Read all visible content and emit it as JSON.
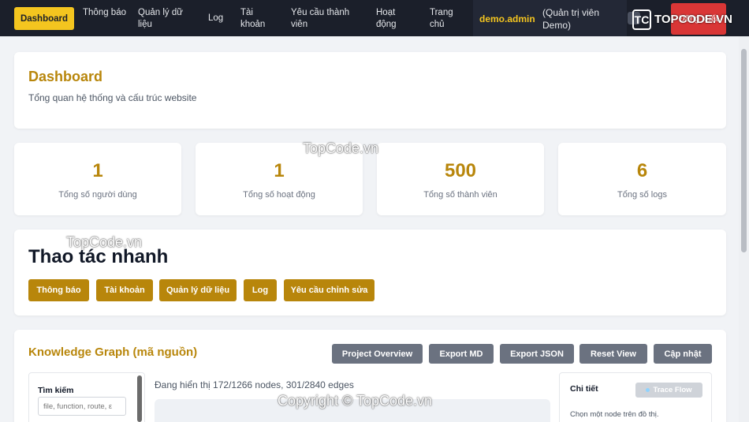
{
  "nav": {
    "items": [
      {
        "label": "Dashboard"
      },
      {
        "label": "Thông báo"
      },
      {
        "label": "Quản lý dữ liệu"
      },
      {
        "label": "Log"
      },
      {
        "label": "Tài khoản"
      },
      {
        "label": "Yêu cầu thành viên"
      },
      {
        "label": "Hoạt động"
      },
      {
        "label": "Trang chủ"
      }
    ],
    "user_name": "demo.admin",
    "user_role": "(Quản trị viên Demo)",
    "logout_label": "Đăng xuất"
  },
  "dashboard": {
    "title": "Dashboard",
    "subtitle": "Tổng quan hệ thống và cấu trúc website"
  },
  "stats": [
    {
      "value": "1",
      "label": "Tổng số người dùng"
    },
    {
      "value": "1",
      "label": "Tổng số hoạt động"
    },
    {
      "value": "500",
      "label": "Tổng số thành viên"
    },
    {
      "value": "6",
      "label": "Tổng số logs"
    }
  ],
  "quick_actions": {
    "title": "Thao tác nhanh",
    "buttons": [
      "Thông báo",
      "Tài khoản",
      "Quản lý dữ liệu",
      "Log",
      "Yêu cầu chỉnh sửa"
    ]
  },
  "knowledge_graph": {
    "title": "Knowledge Graph (mã nguồn)",
    "buttons": [
      "Project Overview",
      "Export MD",
      "Export JSON",
      "Reset View",
      "Cập nhật"
    ],
    "search_label": "Tìm kiếm",
    "search_placeholder": "file, function, route, ε",
    "status": "Đang hiển thị 172/1266 nodes, 301/2840 edges",
    "detail_title": "Chi tiết",
    "trace_label": "Trace Flow",
    "detail_hint": "Chọn một node trên đồ thị."
  },
  "watermarks": {
    "logo_icon": "TC",
    "logo_text": "TOPCODE.VN",
    "center_1": "TopCode.vn",
    "center_2": "TopCode.vn",
    "copyright": "Copyright © TopCode.vn"
  },
  "colors": {
    "accent": "#b8860b",
    "nav_bg": "#1b1f2a",
    "nav_active": "#f4c51f",
    "logout": "#d93636",
    "secondary_button": "#6b7280"
  }
}
